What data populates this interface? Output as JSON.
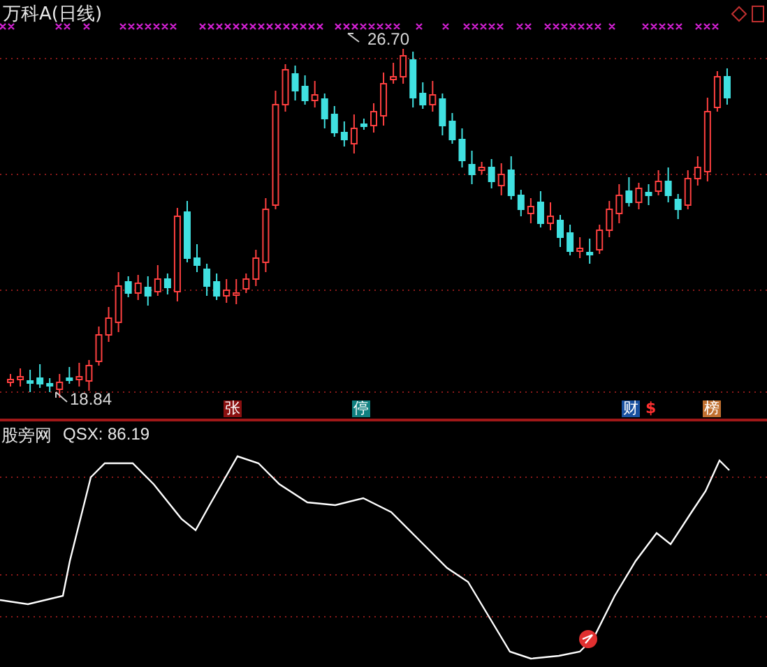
{
  "main_chart": {
    "title": "万科A(日线)",
    "high_label": "26.70",
    "low_label": "18.84",
    "events": [
      {
        "kind": "limit",
        "text": "张"
      },
      {
        "kind": "halt",
        "text": "停"
      },
      {
        "kind": "finance",
        "text": "财"
      },
      {
        "kind": "money",
        "text": "$"
      },
      {
        "kind": "rank",
        "text": "榜"
      }
    ]
  },
  "indicator": {
    "name": "股旁网",
    "reading": "QSX: 86.19"
  }
}
